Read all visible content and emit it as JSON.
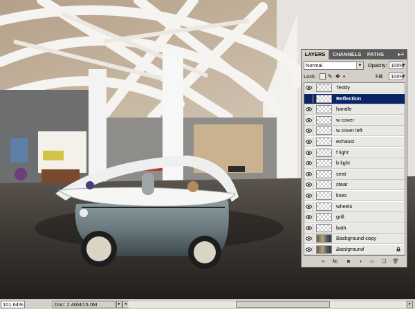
{
  "layers_panel": {
    "tabs": [
      "LAYERS",
      "CHANNELS",
      "PATHS"
    ],
    "menu_button": "▸≡",
    "blend_mode": "Normal",
    "opacity_label": "Opacity:",
    "opacity_value": "100%",
    "lock_label": "Lock:",
    "fill_label": "Fill:",
    "fill_value": "100%",
    "layers": [
      {
        "name": "Teddy"
      },
      {
        "name": "Reflection",
        "selected": true
      },
      {
        "name": "handle"
      },
      {
        "name": "w cover"
      },
      {
        "name": "w cover left"
      },
      {
        "name": "exhaust"
      },
      {
        "name": "f light"
      },
      {
        "name": "b light"
      },
      {
        "name": "seat"
      },
      {
        "name": "stear"
      },
      {
        "name": "lines"
      },
      {
        "name": "wheels"
      },
      {
        "name": "grill"
      },
      {
        "name": "bath"
      },
      {
        "name": "Background copy",
        "photo": true
      },
      {
        "name": "Background",
        "photo": true,
        "italic": true,
        "locked": true
      }
    ]
  },
  "status_bar": {
    "zoom": "101.64%",
    "doc": "Doc: 2.46M/15.0M"
  },
  "colors": {
    "panel_bg": "#d4d0c8",
    "selected_row": "#0a246a",
    "tab_bar": "#5a5a5a"
  }
}
